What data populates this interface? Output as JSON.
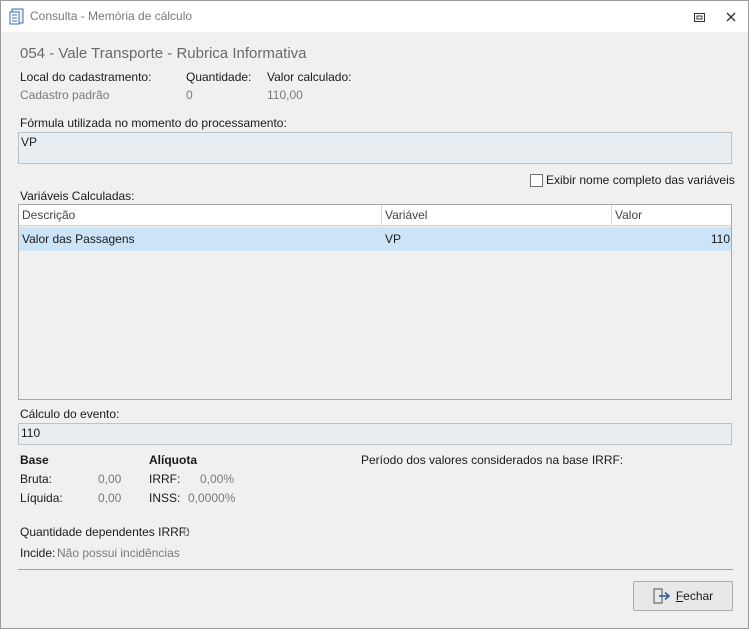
{
  "window": {
    "title": "Consulta - Memória de cálculo",
    "icons": {
      "app": "document-calc-icon",
      "restore": "restore-icon",
      "close": "close-icon"
    }
  },
  "heading": "054 - Vale Transporte - Rubrica Informativa",
  "summary": {
    "local_label": "Local do cadastramento:",
    "local_value": "Cadastro padrão",
    "quantidade_label": "Quantidade:",
    "quantidade_value": "0",
    "valor_label": "Valor calculado:",
    "valor_value": "110,00"
  },
  "formula": {
    "label": "Fórmula utilizada no momento do processamento:",
    "value": "VP"
  },
  "show_full_names": {
    "label": "Exibir nome completo das variáveis",
    "checked": false
  },
  "variables": {
    "label": "Variáveis Calculadas:",
    "columns": [
      "Descrição",
      "Variável",
      "Valor"
    ],
    "rows": [
      {
        "descricao": "Valor das Passagens",
        "variavel": "VP",
        "valor": "110"
      }
    ],
    "selected_row_color": "#cce4f7"
  },
  "evento": {
    "label": "Cálculo do evento:",
    "value": "110"
  },
  "base": {
    "title": "Base",
    "bruta_label": "Bruta:",
    "bruta_value": "0,00",
    "liquida_label": "Líquida:",
    "liquida_value": "0,00"
  },
  "aliquota": {
    "title": "Alíquota",
    "irrf_label": "IRRF:",
    "irrf_value": "0,00%",
    "inss_label": "INSS:",
    "inss_value": "0,0000%"
  },
  "periodo_label": "Período dos valores considerados na base IRRF:",
  "dependentes": {
    "label": "Quantidade dependentes IRRF:",
    "value": "0"
  },
  "incide": {
    "label": "Incide:",
    "value": "Não possui incidências"
  },
  "buttons": {
    "fechar_label": "Fechar",
    "fechar_icon": "exit-icon"
  }
}
